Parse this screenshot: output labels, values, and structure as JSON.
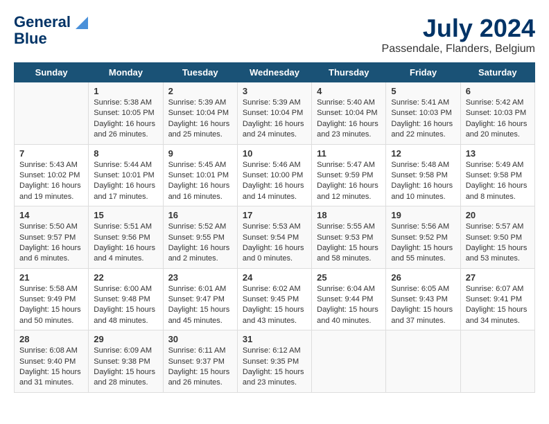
{
  "app": {
    "name": "GeneralBlue",
    "logo_line1": "General",
    "logo_line2": "Blue"
  },
  "header": {
    "month_year": "July 2024",
    "location": "Passendale, Flanders, Belgium"
  },
  "weekdays": [
    "Sunday",
    "Monday",
    "Tuesday",
    "Wednesday",
    "Thursday",
    "Friday",
    "Saturday"
  ],
  "weeks": [
    [
      {
        "day": "",
        "content": ""
      },
      {
        "day": "1",
        "content": "Sunrise: 5:38 AM\nSunset: 10:05 PM\nDaylight: 16 hours\nand 26 minutes."
      },
      {
        "day": "2",
        "content": "Sunrise: 5:39 AM\nSunset: 10:04 PM\nDaylight: 16 hours\nand 25 minutes."
      },
      {
        "day": "3",
        "content": "Sunrise: 5:39 AM\nSunset: 10:04 PM\nDaylight: 16 hours\nand 24 minutes."
      },
      {
        "day": "4",
        "content": "Sunrise: 5:40 AM\nSunset: 10:04 PM\nDaylight: 16 hours\nand 23 minutes."
      },
      {
        "day": "5",
        "content": "Sunrise: 5:41 AM\nSunset: 10:03 PM\nDaylight: 16 hours\nand 22 minutes."
      },
      {
        "day": "6",
        "content": "Sunrise: 5:42 AM\nSunset: 10:03 PM\nDaylight: 16 hours\nand 20 minutes."
      }
    ],
    [
      {
        "day": "7",
        "content": "Sunrise: 5:43 AM\nSunset: 10:02 PM\nDaylight: 16 hours\nand 19 minutes."
      },
      {
        "day": "8",
        "content": "Sunrise: 5:44 AM\nSunset: 10:01 PM\nDaylight: 16 hours\nand 17 minutes."
      },
      {
        "day": "9",
        "content": "Sunrise: 5:45 AM\nSunset: 10:01 PM\nDaylight: 16 hours\nand 16 minutes."
      },
      {
        "day": "10",
        "content": "Sunrise: 5:46 AM\nSunset: 10:00 PM\nDaylight: 16 hours\nand 14 minutes."
      },
      {
        "day": "11",
        "content": "Sunrise: 5:47 AM\nSunset: 9:59 PM\nDaylight: 16 hours\nand 12 minutes."
      },
      {
        "day": "12",
        "content": "Sunrise: 5:48 AM\nSunset: 9:58 PM\nDaylight: 16 hours\nand 10 minutes."
      },
      {
        "day": "13",
        "content": "Sunrise: 5:49 AM\nSunset: 9:58 PM\nDaylight: 16 hours\nand 8 minutes."
      }
    ],
    [
      {
        "day": "14",
        "content": "Sunrise: 5:50 AM\nSunset: 9:57 PM\nDaylight: 16 hours\nand 6 minutes."
      },
      {
        "day": "15",
        "content": "Sunrise: 5:51 AM\nSunset: 9:56 PM\nDaylight: 16 hours\nand 4 minutes."
      },
      {
        "day": "16",
        "content": "Sunrise: 5:52 AM\nSunset: 9:55 PM\nDaylight: 16 hours\nand 2 minutes."
      },
      {
        "day": "17",
        "content": "Sunrise: 5:53 AM\nSunset: 9:54 PM\nDaylight: 16 hours\nand 0 minutes."
      },
      {
        "day": "18",
        "content": "Sunrise: 5:55 AM\nSunset: 9:53 PM\nDaylight: 15 hours\nand 58 minutes."
      },
      {
        "day": "19",
        "content": "Sunrise: 5:56 AM\nSunset: 9:52 PM\nDaylight: 15 hours\nand 55 minutes."
      },
      {
        "day": "20",
        "content": "Sunrise: 5:57 AM\nSunset: 9:50 PM\nDaylight: 15 hours\nand 53 minutes."
      }
    ],
    [
      {
        "day": "21",
        "content": "Sunrise: 5:58 AM\nSunset: 9:49 PM\nDaylight: 15 hours\nand 50 minutes."
      },
      {
        "day": "22",
        "content": "Sunrise: 6:00 AM\nSunset: 9:48 PM\nDaylight: 15 hours\nand 48 minutes."
      },
      {
        "day": "23",
        "content": "Sunrise: 6:01 AM\nSunset: 9:47 PM\nDaylight: 15 hours\nand 45 minutes."
      },
      {
        "day": "24",
        "content": "Sunrise: 6:02 AM\nSunset: 9:45 PM\nDaylight: 15 hours\nand 43 minutes."
      },
      {
        "day": "25",
        "content": "Sunrise: 6:04 AM\nSunset: 9:44 PM\nDaylight: 15 hours\nand 40 minutes."
      },
      {
        "day": "26",
        "content": "Sunrise: 6:05 AM\nSunset: 9:43 PM\nDaylight: 15 hours\nand 37 minutes."
      },
      {
        "day": "27",
        "content": "Sunrise: 6:07 AM\nSunset: 9:41 PM\nDaylight: 15 hours\nand 34 minutes."
      }
    ],
    [
      {
        "day": "28",
        "content": "Sunrise: 6:08 AM\nSunset: 9:40 PM\nDaylight: 15 hours\nand 31 minutes."
      },
      {
        "day": "29",
        "content": "Sunrise: 6:09 AM\nSunset: 9:38 PM\nDaylight: 15 hours\nand 28 minutes."
      },
      {
        "day": "30",
        "content": "Sunrise: 6:11 AM\nSunset: 9:37 PM\nDaylight: 15 hours\nand 26 minutes."
      },
      {
        "day": "31",
        "content": "Sunrise: 6:12 AM\nSunset: 9:35 PM\nDaylight: 15 hours\nand 23 minutes."
      },
      {
        "day": "",
        "content": ""
      },
      {
        "day": "",
        "content": ""
      },
      {
        "day": "",
        "content": ""
      }
    ]
  ]
}
